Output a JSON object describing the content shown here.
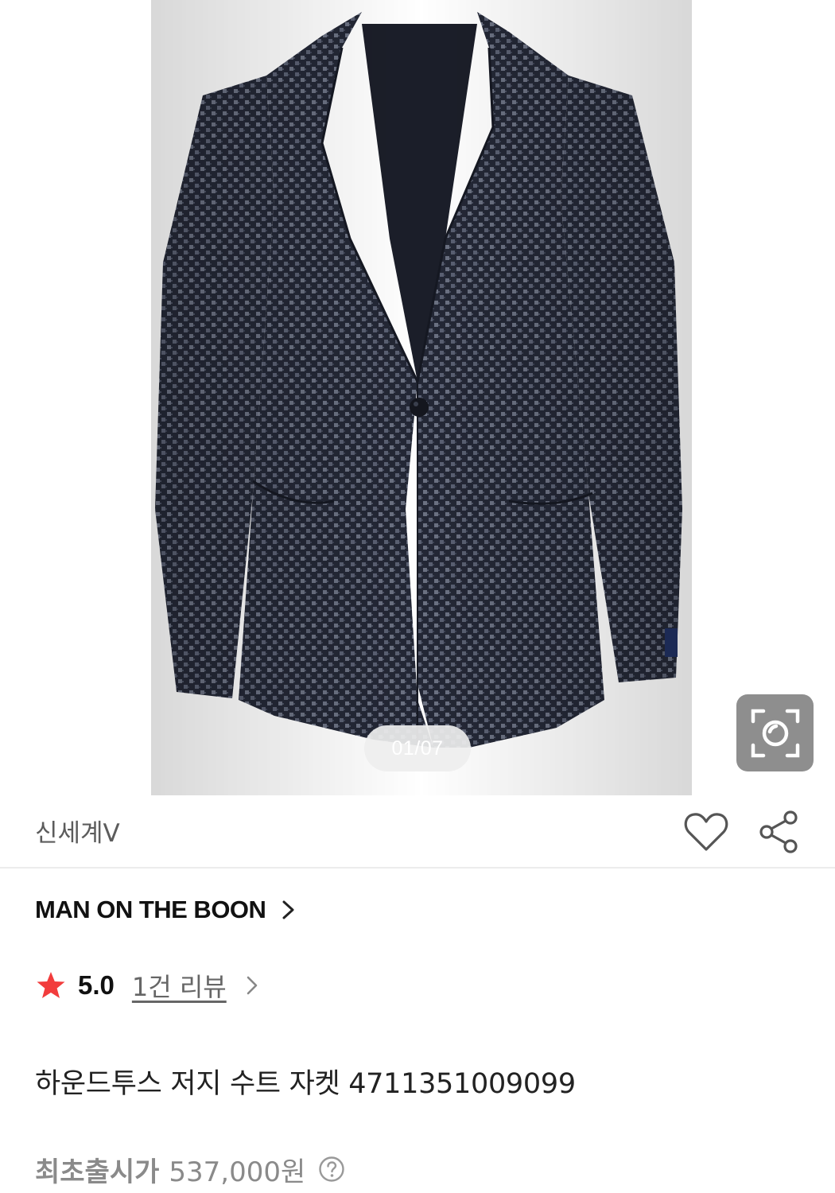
{
  "gallery": {
    "image_alt": "houndstooth jersey suit jacket",
    "indicator": "01/07",
    "lens_icon": "camera-lens-icon"
  },
  "seller": {
    "name": "신세계V",
    "wishlist_icon": "heart-icon",
    "share_icon": "share-icon"
  },
  "brand": {
    "name": "MAN ON THE BOON",
    "chevron_icon": "chevron-right-icon"
  },
  "rating": {
    "score": "5.0",
    "review_link": "1건 리뷰",
    "star_icon": "star-icon",
    "star_color": "#f23c3c"
  },
  "product": {
    "title": "하운드투스 저지 수트 자켓 4711351009099"
  },
  "price": {
    "label": "최초출시가",
    "value": "537,000원",
    "help_icon": "question-circle-icon"
  },
  "colors": {
    "jacket": "#262a37",
    "divider": "#ececec",
    "muted_text": "#8a8a8a"
  }
}
